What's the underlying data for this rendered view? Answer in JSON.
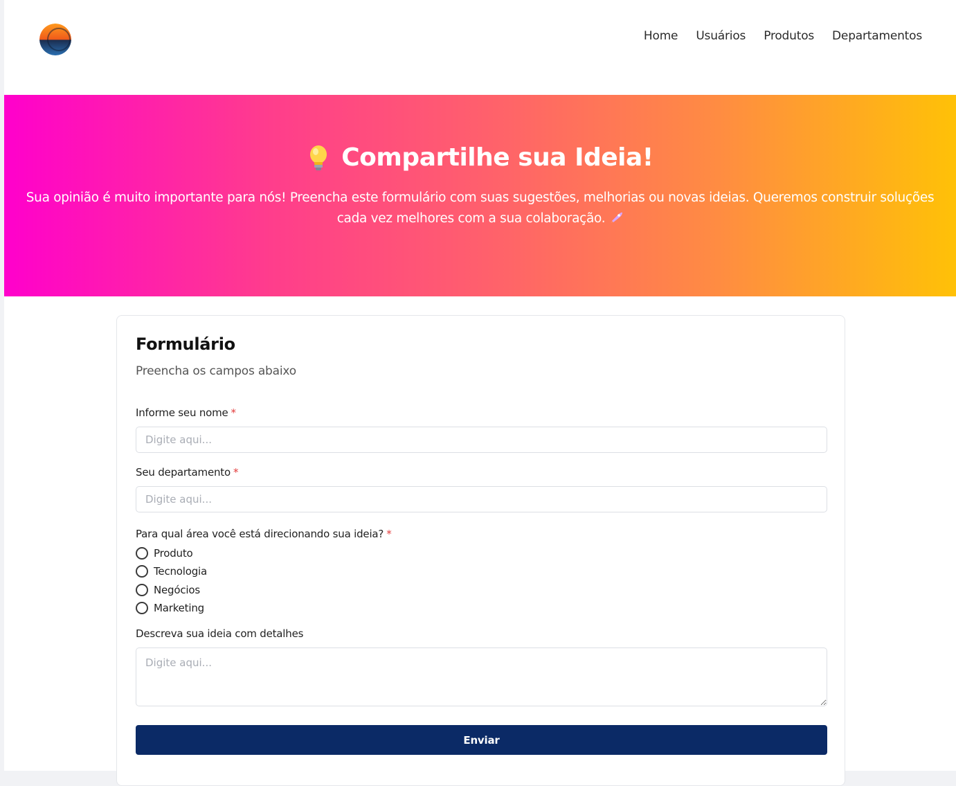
{
  "nav": {
    "items": [
      {
        "label": "Home"
      },
      {
        "label": "Usuários"
      },
      {
        "label": "Produtos"
      },
      {
        "label": "Departamentos"
      }
    ]
  },
  "hero": {
    "icon": "lightbulb-icon",
    "title": "Compartilhe sua Ideia!",
    "subtitle": "Sua opinião é muito importante para nós! Preencha este formulário com suas sugestões, melhorias ou novas ideias. Queremos construir soluções cada vez melhores com a sua colaboração.",
    "subtitle_icon": "rocket-icon",
    "gradient": [
      "#ff00cc",
      "#ff5f6d",
      "#ffc107"
    ]
  },
  "form": {
    "title": "Formulário",
    "subtitle": "Preencha os campos abaixo",
    "name_label": "Informe seu nome",
    "name_placeholder": "Digite aqui...",
    "department_label": "Seu departamento",
    "department_placeholder": "Digite aqui...",
    "area_label": "Para qual área você está direcionando sua ideia?",
    "required_mark": "*",
    "area_options": [
      "Produto",
      "Tecnologia",
      "Negócios",
      "Marketing"
    ],
    "details_label": "Descreva sua ideia com detalhes",
    "details_placeholder": "Digite aqui...",
    "submit_label": "Enviar",
    "submit_color": "#0b2a66"
  }
}
